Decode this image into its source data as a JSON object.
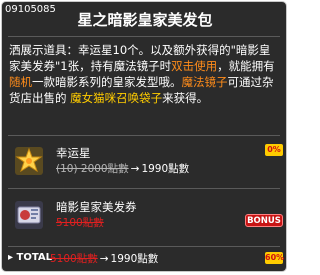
{
  "item_id": "09105085",
  "title": "星之暗影皇家美发包",
  "description": {
    "p1": "洒展示道具：幸运星10个。以及额外获得的\"暗影皇家美发券\"1张，持有魔法镜子时",
    "p1_hl": "双击使用",
    "p2": "，就能拥有",
    "p2_hl": "随机",
    "p3": "一款暗影系列的皇家发型哦。",
    "p3_hl": "魔法镜子",
    "p4": "可通过杂货店出售的 ",
    "p4_hl": "魔女猫咪召唤袋子",
    "p5": "来获得。"
  },
  "items": [
    {
      "name": "幸运星",
      "old_price": "(10) 2000點數",
      "arrow": "→",
      "new_price": "1990點數",
      "badge": "0%",
      "icon": "lucky-star-icon"
    },
    {
      "name": "暗影皇家美发券",
      "old_price": "5100點數",
      "badge": "BONUS",
      "icon": "hair-coupon-icon"
    }
  ],
  "total": {
    "label": "▸ TOTAL",
    "old_price": "5100點數",
    "arrow": "→",
    "new_price": "1990點數",
    "badge": "60%"
  },
  "colors": {
    "panel_bg": "#2b2b2b",
    "highlight": "#ff8c1a",
    "badge_yellow": "#ffcc00",
    "bonus_red": "#c81414"
  }
}
